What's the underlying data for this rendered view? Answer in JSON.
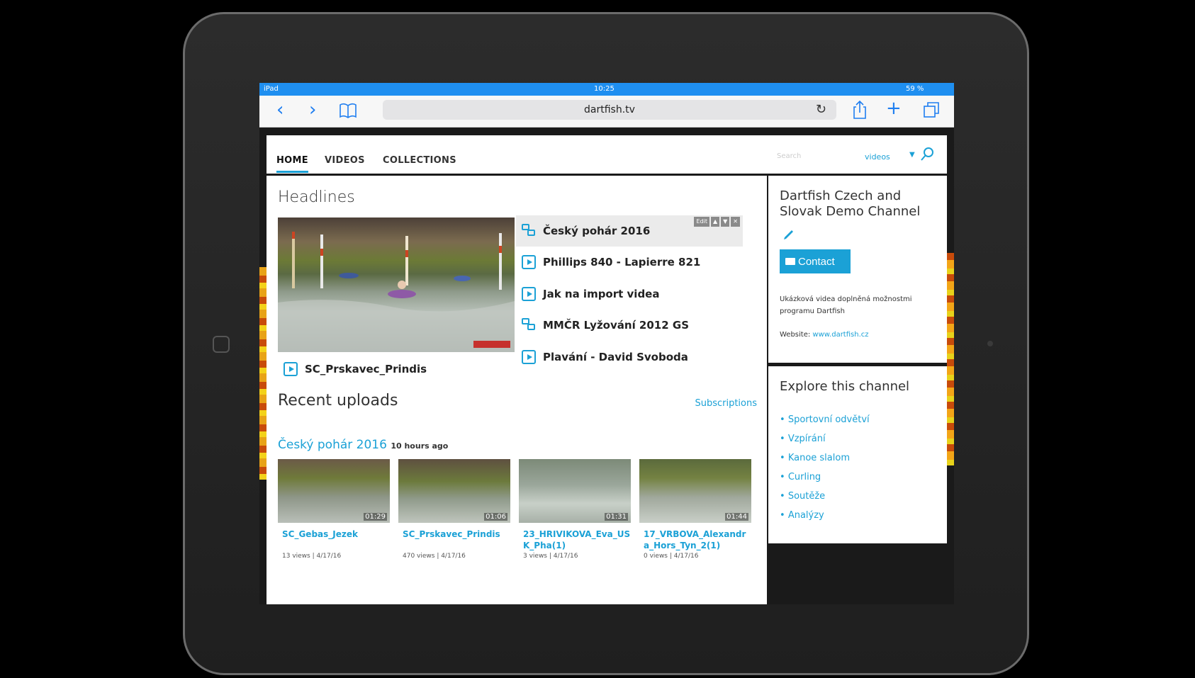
{
  "status_bar": {
    "left": "iPad",
    "time": "10:25",
    "battery": "59 %"
  },
  "safari": {
    "url": "dartfish.tv"
  },
  "nav": {
    "tabs": [
      "HOME",
      "VIDEOS",
      "COLLECTIONS"
    ],
    "search_placeholder": "Search",
    "search_scope": "videos"
  },
  "headlines": {
    "title": "Headlines",
    "featured_caption": "SC_Prskavec_Prindis",
    "items": [
      {
        "label": "Český pohár 2016",
        "type": "collection"
      },
      {
        "label": "Phillips 840 - Lapierre 821",
        "type": "video"
      },
      {
        "label": "Jak na import videa",
        "type": "video"
      },
      {
        "label": "MMČR Lyžování 2012 GS",
        "type": "collection"
      },
      {
        "label": "Plavání - David Svoboda",
        "type": "video"
      }
    ],
    "controls": [
      "Edit",
      "▲",
      "▼",
      "✕"
    ]
  },
  "recent": {
    "title": "Recent uploads",
    "subscriptions_link": "Subscriptions",
    "collection_name": "Český pohár 2016",
    "collection_time": "10 hours ago",
    "videos": [
      {
        "title": "SC_Gebas_Jezek",
        "duration": "01:29",
        "meta": "13 views  |  4/17/16"
      },
      {
        "title": "SC_Prskavec_Prindis",
        "duration": "01:06",
        "meta": "470 views  |  4/17/16"
      },
      {
        "title": "23_HRIVIKOVA_Eva_USK_Pha(1)",
        "duration": "01:31",
        "meta": "3 views  |  4/17/16"
      },
      {
        "title": "17_VRBOVA_Alexandra_Hors_Tyn_2(1)",
        "duration": "01:44",
        "meta": "0 views  |  4/17/16"
      }
    ]
  },
  "sidebar": {
    "channel_title": "Dartfish Czech and Slovak Demo Channel",
    "contact_label": "Contact",
    "description": "Ukázková videa doplněná možnostmi programu Dartfish",
    "website_label": "Website:",
    "website_url": "www.dartfish.cz",
    "explore_title": "Explore this channel",
    "explore_items": [
      "Sportovní odvětví",
      "Vzpírání",
      "Kanoe slalom",
      "Curling",
      "Soutěže",
      "Analýzy"
    ]
  },
  "colors": {
    "accent": "#1ba1d6",
    "status_bar": "#1f8ff0"
  }
}
